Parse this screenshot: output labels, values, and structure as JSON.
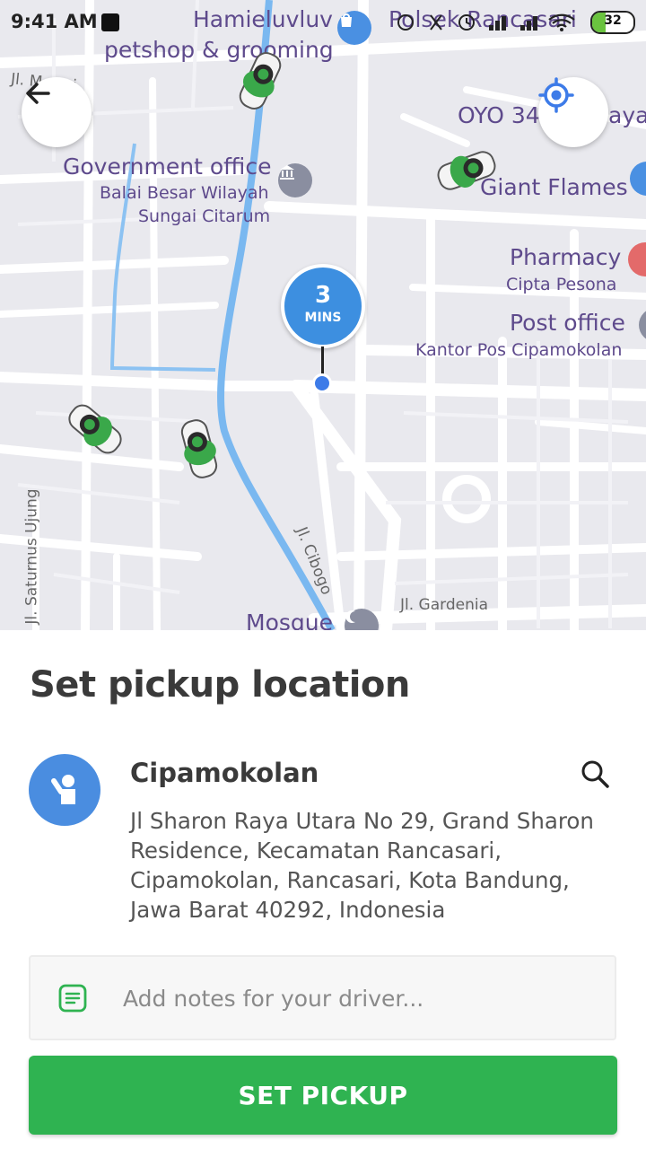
{
  "status_bar": {
    "time": "9:41 AM",
    "battery": "32"
  },
  "map": {
    "labels": {
      "hamieluvluv": "Hamieluvluv",
      "petshop": "petshop & grooming",
      "polsek": "Polsek Rancasari",
      "jl_top_left": "Jl. M...ari",
      "oyo": "OYO 34",
      "oyo_tail": "aya",
      "gov_office": "Government office",
      "balai": "Balai Besar Wilayah",
      "sungai": "Sungai Citarum",
      "giant_flames": "Giant Flames",
      "pharmacy": "Pharmacy",
      "cipta": "Cipta Pesona",
      "post_office": "Post office",
      "kantor_pos": "Kantor Pos Cipamokolan",
      "jl_saturnus": "Jl. Saturnus Ujung",
      "jl_cibogo": "Jl. Cibogo",
      "jl_gardenia": "Jl. Gardenia",
      "mosque": "Mosque"
    },
    "eta": {
      "value": "3",
      "unit": "MINS"
    }
  },
  "sheet": {
    "title": "Set pickup location",
    "location_name": "Cipamokolan",
    "address": "Jl Sharon Raya Utara No 29, Grand Sharon Residence, Kecamatan Rancasari, Cipamokolan, Rancasari, Kota Bandung, Jawa Barat 40292, Indonesia",
    "notes_placeholder": "Add notes for your driver...",
    "button_label": "SET PICKUP"
  },
  "colors": {
    "primary_green": "#2fb351",
    "eta_blue": "#3d8fe0",
    "river_blue": "#7ab8f0"
  }
}
